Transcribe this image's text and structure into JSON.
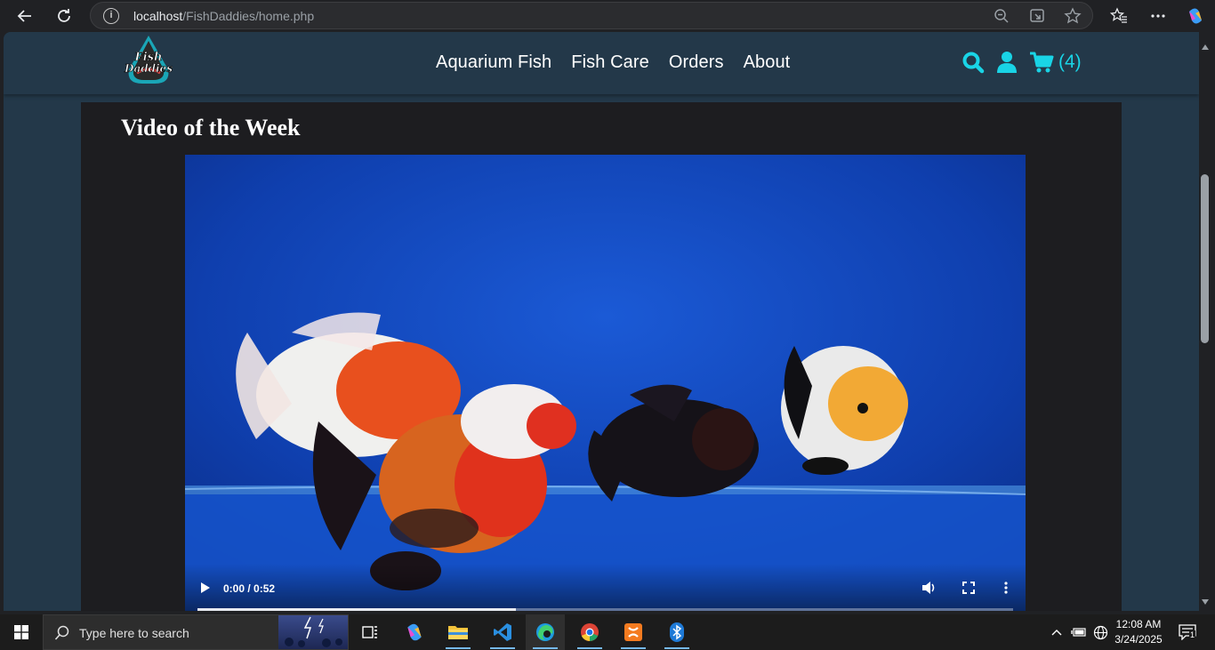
{
  "browser": {
    "url_host": "localhost",
    "url_path": "/FishDaddies/home.php"
  },
  "site": {
    "logo_text": "Fish Daddies",
    "nav": [
      "Aquarium Fish",
      "Fish Care",
      "Orders",
      "About"
    ],
    "cart_count": "(4)",
    "accent_color": "#19d4e6",
    "header_bg": "#233849"
  },
  "main": {
    "section_title": "Video of the Week",
    "video": {
      "time": "0:00 / 0:52",
      "progress": 0.39
    }
  },
  "taskbar": {
    "search_placeholder": "Type here to search",
    "time": "12:08 AM",
    "date": "3/24/2025",
    "notification_count": "1"
  }
}
